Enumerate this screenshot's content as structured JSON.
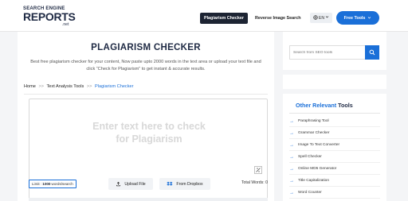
{
  "header": {
    "logo": {
      "line1": "SEARCH ENGINE",
      "line2": "REPORTS",
      "line3": ".net"
    },
    "nav_active": "Plagiarism Checker",
    "nav_link": "Reverse Image Search",
    "lang": "EN",
    "free_tools": "Free Tools"
  },
  "main": {
    "title": "PLAGIARISM CHECKER",
    "description": "Best free plagiarism checker for your content, Now paste upto 2000 words in the text area or upload your text file and click “Check for Plagiarism” to get instant & accurate results.",
    "breadcrumb": [
      "Home",
      "Text Analysis Tools",
      "Plagiarism Checker"
    ],
    "breadcrumb_sep": ">>",
    "editor_placeholder": "Enter text here to check\nfor Plagiarism",
    "limit": {
      "label": "Limit :",
      "value": "1000",
      "suffix": "words/search"
    },
    "upload_label": "Upload File",
    "dropbox_label": "From Dropbox",
    "word_count": "Total Words: 0"
  },
  "sidebar": {
    "search_placeholder": "Search from SEO tools",
    "tools_title": {
      "blue": "Other Relevant",
      "dark": "Tools"
    },
    "tools": [
      "Paraphrasing Tool",
      "Grammar Checker",
      "Image To Text Converter",
      "Spell Checker",
      "Online MD5 Generator",
      "Title Capitalization",
      "Word Counter"
    ]
  },
  "colors": {
    "accent": "#1a6fd8",
    "dark": "#1d2433"
  }
}
